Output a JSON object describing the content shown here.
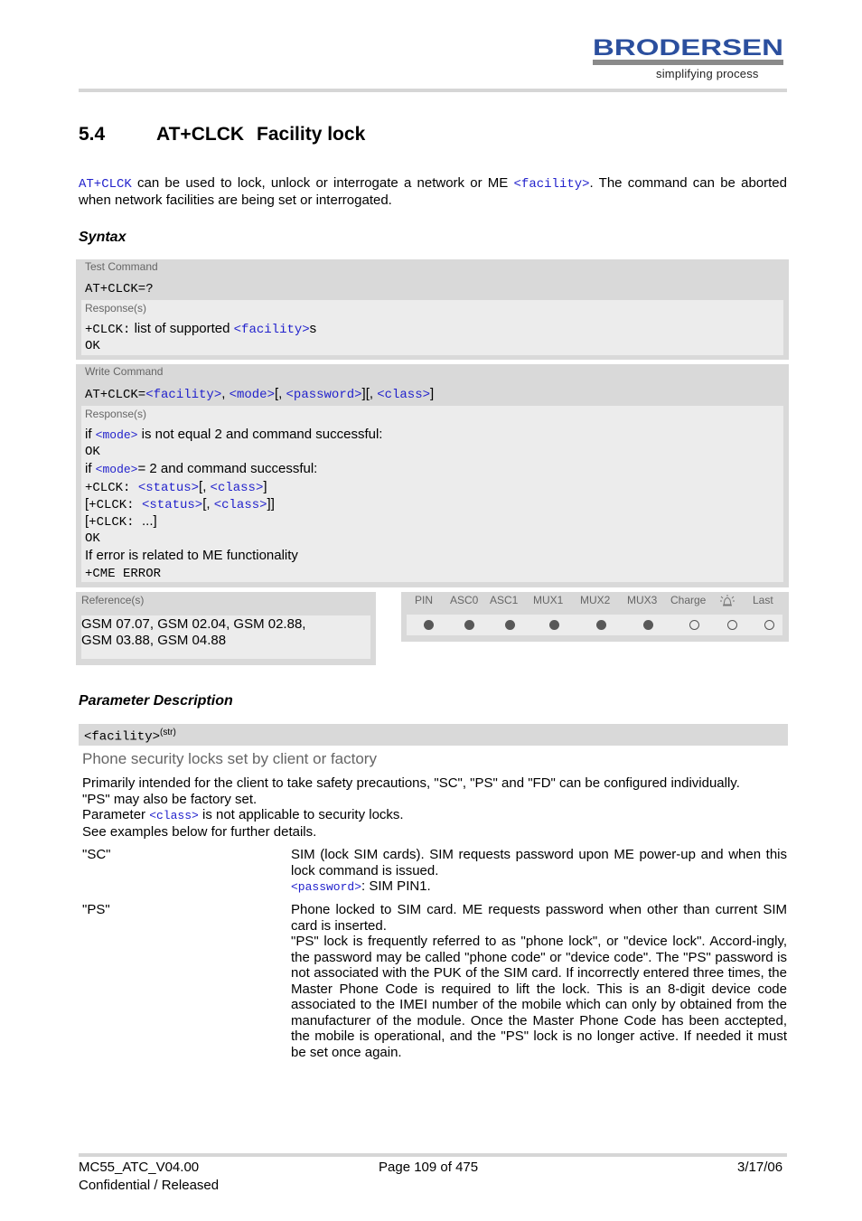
{
  "header": {
    "logo_text": "BRODERSEN",
    "logo_tagline": "simplifying process",
    "brand_color": "#2b4f9e"
  },
  "section": {
    "number": "5.4",
    "command": "AT+CLCK",
    "title": "Facility lock"
  },
  "intro": {
    "cmd": "AT+CLCK",
    "text1": " can be used to lock, unlock or interrogate a network or ME ",
    "param": "<facility>",
    "text2": ". The command can be aborted when network facilities are being set or interrogated."
  },
  "syntax": {
    "heading": "Syntax",
    "test": {
      "label": "Test Command",
      "command": "AT+CLCK=?",
      "response_label": "Response(s)",
      "resp_prefix": "+CLCK:",
      "resp_text": " list of supported ",
      "resp_param": "<facility>",
      "resp_suffix": "s",
      "ok": "OK"
    },
    "write": {
      "label": "Write Command",
      "cmd_prefix": "AT+CLCK=",
      "p_facility": "<facility>",
      "sep1": ", ",
      "p_mode": "<mode>",
      "sep2": "[, ",
      "p_password": "<password>",
      "sep3": "][, ",
      "p_class": "<class>",
      "sep4": "]",
      "response_label": "Response(s)",
      "lines": {
        "l1_if": "if ",
        "l1_param": "<mode>",
        "l1_text": " is not equal 2 and command successful:",
        "l2": "OK",
        "l3_if": "if ",
        "l3_param": "<mode>",
        "l3_text": "= 2 and command successful:",
        "l4_prefix": "+CLCK: ",
        "l4_status": "<status>",
        "l4_sep": "[, ",
        "l4_class": "<class>",
        "l4_end": "]",
        "l5_open": "[",
        "l5_prefix": "+CLCK: ",
        "l5_status": "<status>",
        "l5_sep": "[, ",
        "l5_class": "<class>",
        "l5_end": "]]",
        "l6_open": "[",
        "l6_prefix": "+CLCK: ",
        "l6_rest": "...]",
        "l7": "OK",
        "l8": "If error is related to ME functionality",
        "l9": "+CME ERROR"
      }
    },
    "reference": {
      "label": "Reference(s)",
      "line1": "GSM 07.07, GSM 02.04, GSM 02.88,",
      "line2": "GSM 03.88, GSM 04.88"
    },
    "availability": {
      "columns": [
        "PIN",
        "ASC0",
        "ASC1",
        "MUX1",
        "MUX2",
        "MUX3",
        "Charge",
        "alarm-icon",
        "Last"
      ],
      "values": [
        true,
        true,
        true,
        true,
        true,
        true,
        false,
        false,
        false
      ]
    }
  },
  "parameters": {
    "heading": "Parameter Description",
    "facility": {
      "name": "<facility>",
      "type": "(str)",
      "subtitle": "Phone security locks set by client or factory",
      "desc_line1": "Primarily intended for the client to take safety precautions, \"SC\", \"PS\" and \"FD\" can be configured individually.",
      "desc_line2": "\"PS\" may also be factory set.",
      "desc_line3_pre": "Parameter ",
      "desc_line3_param": "<class>",
      "desc_line3_post": " is not applicable to security locks.",
      "desc_line4": "See examples below for further details.",
      "values": [
        {
          "key": "\"SC\"",
          "desc": "SIM (lock SIM cards). SIM requests password upon ME power-up and when this lock command is issued.",
          "param": "<password>",
          "param_text": ": SIM PIN1."
        },
        {
          "key": "\"PS\"",
          "desc1": "Phone locked to SIM card. ME requests password when other than current SIM card is inserted.",
          "desc2": "\"PS\" lock is frequently referred to as \"phone lock\", or \"device lock\". Accord-ingly, the password may be called \"phone code\" or \"device code\". The \"PS\" password is not associated with the PUK of the SIM card. If incorrectly entered three times, the Master Phone Code is required to lift the lock. This is an 8-digit device code associated to the IMEI number of the mobile which can only by obtained from the manufacturer of the module. Once the Master Phone Code has been acctepted, the mobile is operational, and the \"PS\" lock is no longer active. If needed it must be set once again."
        }
      ]
    }
  },
  "footer": {
    "doc_id": "MC55_ATC_V04.00",
    "status": "Confidential / Released",
    "page": "Page 109 of 475",
    "date": "3/17/06"
  }
}
